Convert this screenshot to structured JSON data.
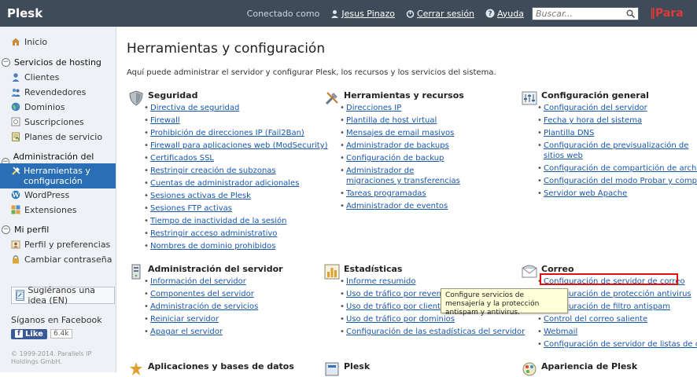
{
  "topbar": {
    "logo": "Plesk",
    "connected_as": "Conectado como",
    "user": "Jesus Pinazo",
    "logout": "Cerrar sesión",
    "help": "Ayuda",
    "search_placeholder": "Buscar...",
    "brand": "Para"
  },
  "sidebar": {
    "home": "Inicio",
    "hosting_header": "Servicios de hosting",
    "hosting_items": [
      "Clientes",
      "Revendedores",
      "Dominios",
      "Suscripciones",
      "Planes de servicio"
    ],
    "admin_header": "Administración del servidor",
    "admin_items": [
      "Herramientas y configuración",
      "WordPress",
      "Extensiones"
    ],
    "profile_header": "Mi perfil",
    "profile_items": [
      "Perfil y preferencias",
      "Cambiar contraseña"
    ],
    "suggest": "Sugiéranos una idea (EN)",
    "follow": "Síganos en Facebook",
    "like": "Like",
    "like_count": "6.4k",
    "copyright": "© 1999-2014. Parallels IP Holdings GmbH."
  },
  "main": {
    "title": "Herramientas y configuración",
    "description": "Aquí puede administrar el servidor y configurar Plesk, los recursos y los servicios del sistema.",
    "sections": {
      "seguridad": {
        "title": "Seguridad",
        "links": [
          "Directiva de seguridad",
          "Firewall",
          "Prohibición de direcciones IP (Fail2Ban)",
          "Firewall para aplicaciones web (ModSecurity)",
          "Certificados SSL",
          "Restringir creación de subzonas",
          "Cuentas de administrador adicionales",
          "Sesiones activas de Plesk",
          "Sesiones FTP activas",
          "Tiempo de inactividad de la sesión",
          "Restringir acceso administrativo",
          "Nombres de dominio prohibidos"
        ]
      },
      "herramientas": {
        "title": "Herramientas y recursos",
        "links": [
          "Direcciones IP",
          "Plantilla de host virtual",
          "Mensajes de email masivos",
          "Administrador de backups",
          "Configuración de backup",
          "Administrador de migraciones y transferencias",
          "Tareas programadas",
          "Administrador de eventos"
        ]
      },
      "config_general": {
        "title": "Configuración general",
        "links": [
          "Configuración del servidor",
          "Fecha y hora del sistema",
          "Plantilla DNS",
          "Configuración de previsualización de sitios web",
          "Configuración de compartición de archivos",
          "Configuración del modo Probar y comprar",
          "Servidor web Apache"
        ]
      },
      "admin_servidor": {
        "title": "Administración del servidor",
        "links": [
          "Información del servidor",
          "Componentes del servidor",
          "Administración de servicios",
          "Reiniciar servidor",
          "Apagar el servidor"
        ]
      },
      "estadisticas": {
        "title": "Estadísticas",
        "links": [
          "Informe resumido",
          "Uso de tráfico por revendedores",
          "Uso de tráfico por clientes",
          "Uso de tráfico por dominios",
          "Configuración de las estadísticas del servidor"
        ]
      },
      "correo": {
        "title": "Correo",
        "links": [
          "Configuración de servidor de correo",
          "Configuración de protección antivirus",
          "Configuración de filtro antispam",
          "Control del correo saliente",
          "Webmail",
          "Configuración de servidor de listas de correo"
        ]
      },
      "aplicaciones": {
        "title": "Aplicaciones y bases de datos"
      },
      "plesk": {
        "title": "Plesk"
      },
      "apariencia": {
        "title": "Apariencia de Plesk"
      }
    },
    "tooltip": "Configure servicios de mensajería y la protección antispam y antivirus."
  }
}
